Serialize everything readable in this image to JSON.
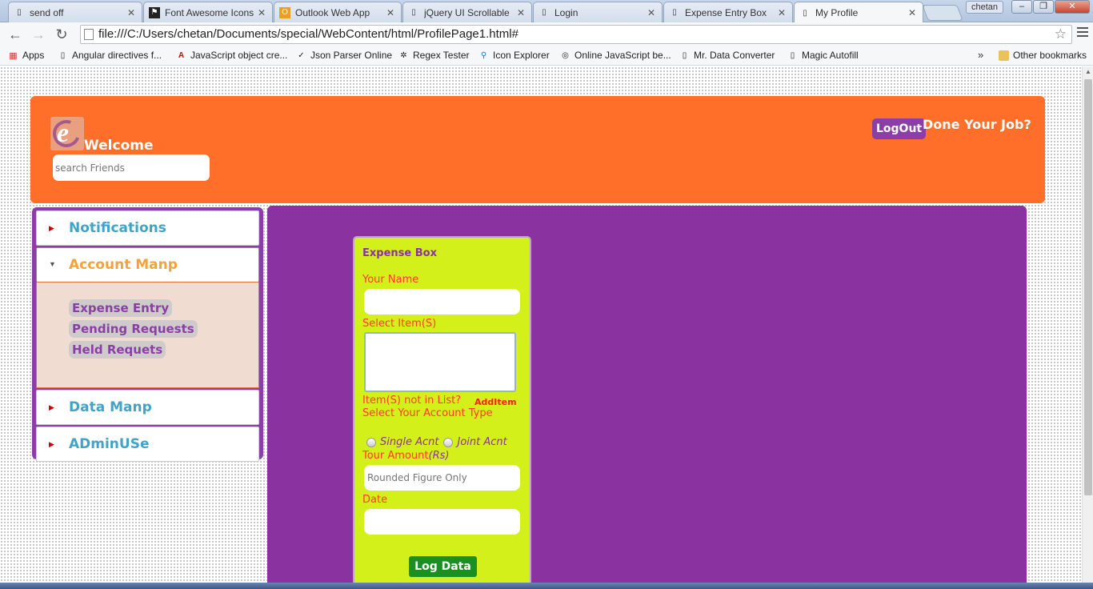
{
  "browser": {
    "tabs": [
      {
        "label": "send off",
        "icon": "document-icon"
      },
      {
        "label": "Font Awesome Icons",
        "icon": "font-awesome-icon"
      },
      {
        "label": "Outlook Web App",
        "icon": "outlook-icon"
      },
      {
        "label": "jQuery UI Scrollable",
        "icon": "document-icon"
      },
      {
        "label": "Login",
        "icon": "document-icon"
      },
      {
        "label": "Expense Entry Box",
        "icon": "document-icon"
      },
      {
        "label": "My Profile",
        "icon": "document-icon",
        "active": true
      }
    ],
    "user": "chetan",
    "url": "file:///C:/Users/chetan/Documents/special/WebContent/html/ProfilePage1.html#",
    "bookmarks": [
      {
        "label": "Apps",
        "icon": "apps-grid-icon"
      },
      {
        "label": "Angular directives f...",
        "icon": "document-icon"
      },
      {
        "label": "JavaScript object cre...",
        "icon": "adobe-icon"
      },
      {
        "label": "Json Parser Online",
        "icon": "json-icon"
      },
      {
        "label": "Regex Tester",
        "icon": "regex-icon"
      },
      {
        "label": "Icon Explorer",
        "icon": "magnifier-icon"
      },
      {
        "label": "Online JavaScript be...",
        "icon": "owl-icon"
      },
      {
        "label": "Mr. Data Converter",
        "icon": "document-icon"
      },
      {
        "label": "Magic Autofill",
        "icon": "document-icon"
      }
    ],
    "more_bookmarks": "»",
    "other_bookmarks": "Other bookmarks"
  },
  "header": {
    "logo_letter": "e",
    "welcome": "Welcome",
    "search_placeholder": "search Friends",
    "logout_label": "LogOut",
    "done_text": "Done Your Job?"
  },
  "sidebar": {
    "sections": [
      {
        "title": "Notifications",
        "open": false
      },
      {
        "title": "Account Manp",
        "open": true,
        "items": [
          "Expense Entry",
          "Pending Requests",
          "Held Requets"
        ]
      },
      {
        "title": "Data Manp",
        "open": false
      },
      {
        "title": "ADminUSe",
        "open": false
      }
    ]
  },
  "expense_box": {
    "title": "Expense Box",
    "name_label": "Your Name",
    "items_label": "Select Item(S)",
    "not_in_list_label": "Item(S) not in List?",
    "add_item_label": "AddItem",
    "account_type_label": "Select Your Account Type",
    "account_options": [
      "Single Acnt",
      "Joint Acnt"
    ],
    "amount_label": "Tour Amount",
    "amount_unit": "(Rs)",
    "amount_placeholder": "Rounded Figure Only",
    "date_label": "Date",
    "submit_label": "Log Data"
  },
  "colors": {
    "header_bg": "#ff6f2a",
    "purple": "#8a32a0",
    "expense_bg": "#d4f01a",
    "label_red": "#ff3a2a",
    "button_green": "#1a9020"
  }
}
